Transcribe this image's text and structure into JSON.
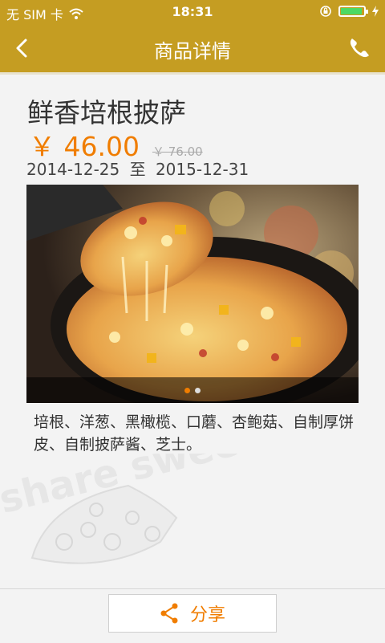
{
  "status_bar": {
    "carrier": "无 SIM 卡",
    "time": "18:31"
  },
  "nav": {
    "title": "商品详情",
    "back_icon": "chevron-left-icon",
    "call_icon": "phone-icon"
  },
  "product": {
    "name": "鲜香培根披萨",
    "price": "￥ 46.00",
    "original_price": "￥ 76.00",
    "start_date": "2014-12-25",
    "date_separator": "至",
    "end_date": "2015-12-31",
    "description": "培根、洋葱、黑橄榄、口蘑、杏鲍菇、自制厚饼皮、自制披萨酱、芝士。",
    "image_count": 2,
    "active_image_index": 0
  },
  "watermark": {
    "text": "share sweet"
  },
  "actions": {
    "share_label": "分享",
    "share_icon": "share-icon"
  },
  "colors": {
    "brand_gold": "#c59d22",
    "accent_orange": "#f07d00"
  }
}
